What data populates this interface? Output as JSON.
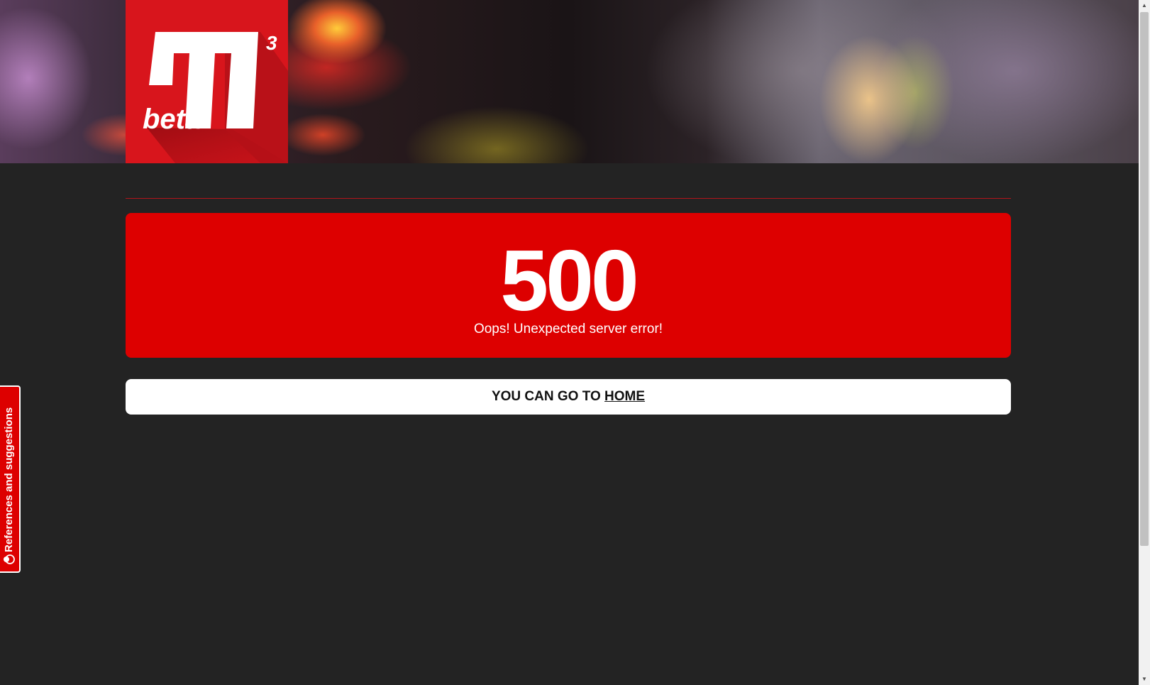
{
  "header": {
    "logo": {
      "brand_mark": "M",
      "superscript": "3",
      "tagline": "beta"
    }
  },
  "error": {
    "code": "500",
    "message": "Oops! Unexpected server error!"
  },
  "navigation": {
    "prefix": "YOU CAN GO TO",
    "home_link": "HOME"
  },
  "feedback": {
    "label": "References and suggestions",
    "icon": "feedback-bubble-icon"
  },
  "colors": {
    "background": "#232323",
    "accent_red": "#dd0000",
    "logo_red": "#d8151c",
    "card_white": "#ffffff"
  }
}
